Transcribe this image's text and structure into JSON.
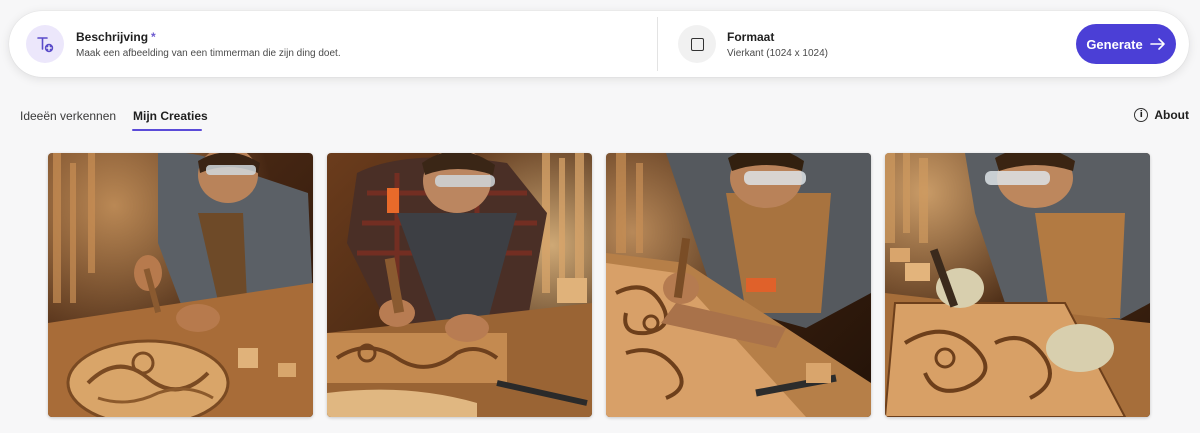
{
  "prompt": {
    "description_label": "Beschrijving",
    "required_marker": "*",
    "description_text": "Maak een afbeelding van een timmerman die zijn ding doet.",
    "format_label": "Formaat",
    "format_value": "Vierkant (1024 x 1024)",
    "generate_label": "Generate",
    "icons": {
      "description": "text-add-icon",
      "format": "square-format-icon",
      "generate": "arrow-right-icon"
    },
    "accent_color": "#4b3fd6"
  },
  "tabs": [
    {
      "label": "Ideeën verkennen",
      "active": false
    },
    {
      "label": "Mijn Creaties",
      "active": true
    }
  ],
  "about": {
    "label": "About",
    "icon": "info-icon"
  },
  "gallery": {
    "images": [
      {
        "subject": "carpenter-carving-wood-image"
      },
      {
        "subject": "carpenter-carving-wood-image"
      },
      {
        "subject": "carpenter-carving-wood-image"
      },
      {
        "subject": "carpenter-carving-wood-image"
      }
    ]
  }
}
